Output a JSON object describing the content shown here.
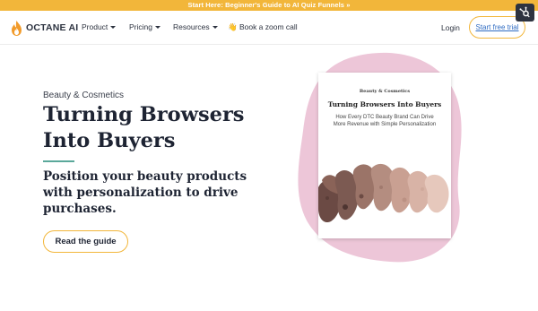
{
  "banner": {
    "text": "Start Here: Beginner's Guide to AI Quiz Funnels »"
  },
  "nav": {
    "logo_text": "OCTANE AI",
    "items": [
      {
        "label": "Product"
      },
      {
        "label": "Pricing"
      },
      {
        "label": "Resources"
      }
    ],
    "zoom_call": "👋 Book a zoom call",
    "login": "Login",
    "trial_button": "Start free trial"
  },
  "hero": {
    "eyebrow": "Beauty & Cosmetics",
    "headline_line1": "Turning Browsers",
    "headline_line2": "Into Buyers",
    "subhead": "Position your beauty products with personalization to drive purchases.",
    "cta_label": "Read the guide"
  },
  "guide_cover": {
    "eyebrow": "Beauty & Cosmetics",
    "title": "Turning Browsers Into Buyers",
    "subtitle": "How Every DTC Beauty Brand Can Drive More Revenue with Simple Personalization"
  },
  "colors": {
    "accent": "#f2b63a",
    "divider": "#5aa89a",
    "blob": "#edc6d8",
    "link": "#2f6cc2",
    "text": "#1e2433"
  }
}
